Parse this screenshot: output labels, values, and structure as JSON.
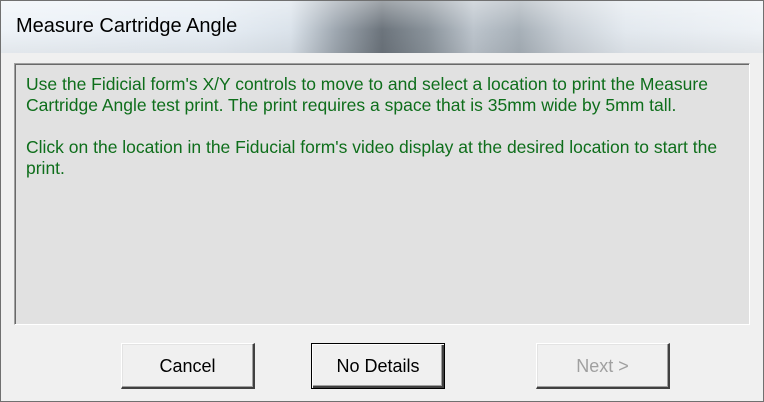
{
  "window": {
    "title": "Measure Cartridge Angle"
  },
  "message": {
    "paragraph1": "Use the Fidicial form's X/Y controls to move to and select a location to print the Measure Cartridge Angle test print. The print requires a space that is 35mm wide by 5mm tall.",
    "paragraph2": "Click on the location in the Fiducial form's video display at the desired location to start the print."
  },
  "buttons": {
    "cancel": "Cancel",
    "details": "No Details",
    "next": "Next >",
    "next_enabled": false
  },
  "colors": {
    "message_text": "#0e6e1b",
    "panel_background": "#e1e1e1",
    "disabled_text": "#a0a0a0"
  }
}
